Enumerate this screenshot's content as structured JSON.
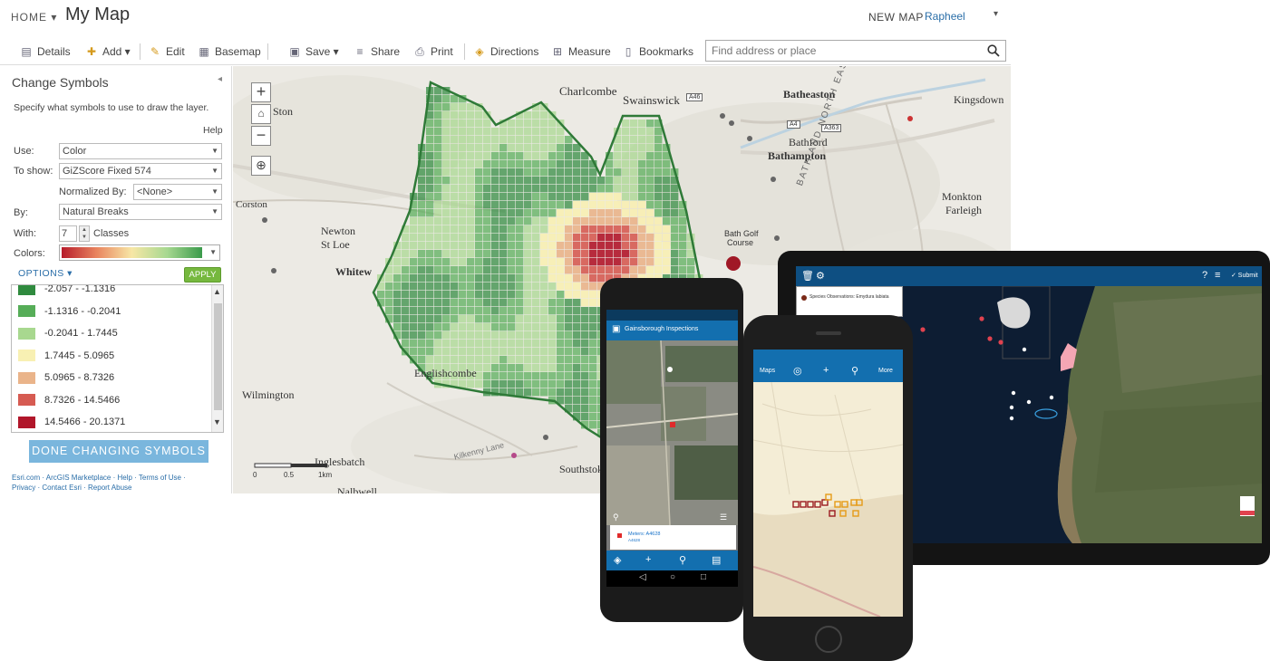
{
  "header": {
    "home_label": "HOME ▾",
    "map_title": "My Map",
    "new_map_label": "NEW MAP",
    "user_name": "Rapheel",
    "user_caret": "▾"
  },
  "toolbar": {
    "details_label": "Details",
    "add_label": "Add ▾",
    "edit_label": "Edit",
    "basemap_label": "Basemap",
    "save_label": "Save ▾",
    "share_label": "Share",
    "print_label": "Print",
    "directions_label": "Directions",
    "measure_label": "Measure",
    "bookmarks_label": "Bookmarks",
    "search_placeholder": "Find address or place"
  },
  "panel": {
    "title": "Change Symbols",
    "collapse_glyph": "◂",
    "description": "Specify what symbols to use to draw the layer.",
    "help_label": "Help",
    "use_label": "Use:",
    "use_value": "Color",
    "to_show_label": "To show:",
    "to_show_value": "GiZScore Fixed 574",
    "normalized_label": "Normalized By:",
    "normalized_value": "<None>",
    "by_label": "By:",
    "by_value": "Natural Breaks",
    "with_label": "With:",
    "classes_count": "7",
    "classes_label": "Classes",
    "colors_label": "Colors:",
    "options_label": "OPTIONS ▾",
    "apply_label": "APPLY",
    "classes": [
      {
        "label": "-2.057 - -1.1316",
        "color": "#2f8a3e"
      },
      {
        "label": "-1.1316 - -0.2041",
        "color": "#56ad58"
      },
      {
        "label": "-0.2041 - 1.7445",
        "color": "#a8d88f"
      },
      {
        "label": "1.7445 - 5.0965",
        "color": "#f8f0b3"
      },
      {
        "label": "5.0965 - 8.7326",
        "color": "#eab48a"
      },
      {
        "label": "8.7326 - 14.5466",
        "color": "#d65b52"
      },
      {
        "label": "14.5466 - 20.1371",
        "color": "#b1162a"
      }
    ],
    "done_label": "DONE CHANGING SYMBOLS",
    "footer_line1": "Esri.com · ArcGIS Marketplace · Help · Terms of Use ·",
    "footer_line2": "Privacy · Contact Esri · Report Abuse"
  },
  "map": {
    "zoom_in": "+",
    "zoom_out": "−",
    "place_labels": [
      "Charlcombe",
      "Swainswick",
      "Batheaston",
      "Kingsdown",
      "Bathford",
      "Bathampton",
      "Monkton",
      "Farleigh",
      "Corston",
      "Newton",
      "St Loe",
      "Whitew",
      "Englishcombe",
      "Wilmington",
      "Inglesbatch",
      "Southstoke",
      "Bath Golf",
      "Course",
      "Ston",
      "Nalbwell"
    ],
    "road_labels": [
      "A46",
      "A4",
      "A363",
      "BATH AND NORTH EAST S",
      "Kilkenny Lane"
    ],
    "scale_labels": [
      "0",
      "0.5",
      "1km"
    ]
  },
  "tablet": {
    "submit_label": "✓ Submit",
    "popup_text": "Species Observations: Emydura labiata"
  },
  "android": {
    "app_title": "Gainsborough Inspections",
    "card_title": "Meters: A4628",
    "card_subtitle": "A4628"
  },
  "iphone": {
    "maps_label": "Maps",
    "more_label": "More"
  },
  "colors": {
    "accent_blue": "#136faf",
    "apply_green": "#76b83e",
    "done_blue": "#7ab6dd",
    "hotspot_red": "#b1162a"
  }
}
